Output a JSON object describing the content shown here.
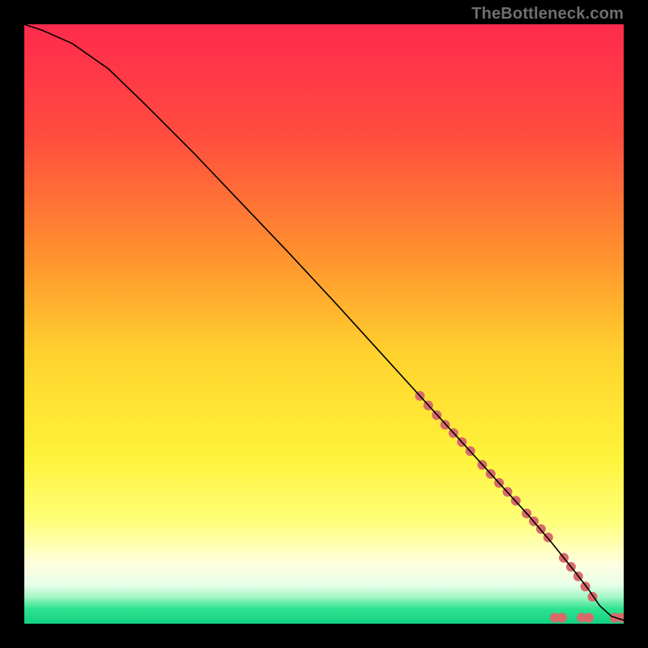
{
  "watermark": "TheBottleneck.com",
  "chart_data": {
    "type": "line",
    "title": "",
    "xlabel": "",
    "ylabel": "",
    "xlim": [
      0,
      100
    ],
    "ylim": [
      0,
      100
    ],
    "grid": false,
    "legend": false,
    "background_gradient": {
      "stops": [
        {
          "offset": 0.0,
          "color": "#ff2a4d"
        },
        {
          "offset": 0.18,
          "color": "#ff4b3f"
        },
        {
          "offset": 0.38,
          "color": "#ff8f2f"
        },
        {
          "offset": 0.55,
          "color": "#ffd22e"
        },
        {
          "offset": 0.72,
          "color": "#fff33a"
        },
        {
          "offset": 0.83,
          "color": "#ffff7a"
        },
        {
          "offset": 0.9,
          "color": "#ffffe0"
        },
        {
          "offset": 0.935,
          "color": "#e8ffe8"
        },
        {
          "offset": 0.955,
          "color": "#a6f7c6"
        },
        {
          "offset": 0.975,
          "color": "#2fe38f"
        },
        {
          "offset": 1.0,
          "color": "#11d184"
        }
      ]
    },
    "series": [
      {
        "name": "bottleneck-curve",
        "color": "#000000",
        "width": 1.6,
        "x": [
          0,
          3,
          8,
          14,
          20,
          28,
          36,
          44,
          52,
          60,
          68,
          76,
          84,
          88,
          90,
          92,
          94,
          96,
          98,
          100
        ],
        "y": [
          100,
          99,
          96.8,
          92.6,
          86.8,
          78.8,
          70.4,
          62.0,
          53.4,
          44.6,
          35.8,
          27.0,
          18.2,
          13.5,
          11.0,
          8.5,
          5.9,
          3.0,
          1.2,
          0.6
        ]
      }
    ],
    "markers": {
      "name": "dotted-segment",
      "color": "#d86a6a",
      "radius": 6,
      "points": [
        {
          "x": 66.0,
          "y": 38.0
        },
        {
          "x": 67.4,
          "y": 36.4
        },
        {
          "x": 68.8,
          "y": 34.8
        },
        {
          "x": 70.2,
          "y": 33.2
        },
        {
          "x": 71.6,
          "y": 31.8
        },
        {
          "x": 73.0,
          "y": 30.3
        },
        {
          "x": 74.4,
          "y": 28.8
        },
        {
          "x": 76.4,
          "y": 26.5
        },
        {
          "x": 77.8,
          "y": 25.0
        },
        {
          "x": 79.2,
          "y": 23.5
        },
        {
          "x": 80.6,
          "y": 22.0
        },
        {
          "x": 82.0,
          "y": 20.5
        },
        {
          "x": 83.8,
          "y": 18.4
        },
        {
          "x": 85.0,
          "y": 17.1
        },
        {
          "x": 86.2,
          "y": 15.8
        },
        {
          "x": 87.4,
          "y": 14.4
        },
        {
          "x": 90.0,
          "y": 11.0
        },
        {
          "x": 91.2,
          "y": 9.5
        },
        {
          "x": 92.4,
          "y": 7.9
        },
        {
          "x": 93.6,
          "y": 6.2
        },
        {
          "x": 94.8,
          "y": 4.5
        },
        {
          "x": 88.5,
          "y": 1.0
        },
        {
          "x": 89.7,
          "y": 1.0
        },
        {
          "x": 93.0,
          "y": 1.0
        },
        {
          "x": 94.2,
          "y": 1.0
        },
        {
          "x": 98.5,
          "y": 1.0
        },
        {
          "x": 99.7,
          "y": 1.0
        }
      ]
    }
  }
}
